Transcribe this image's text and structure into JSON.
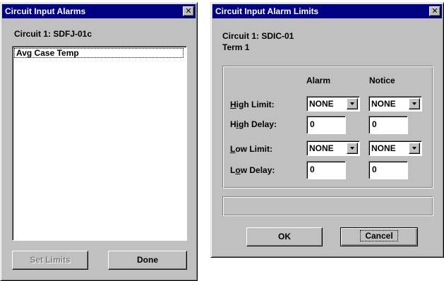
{
  "alarms_dialog": {
    "title": "Circuit Input Alarms",
    "circuit_label": "Circuit 1: SDFJ-01c",
    "list_items": [
      "Avg Case Temp"
    ],
    "set_limits_button": "Set Limits",
    "done_button": "Done"
  },
  "limits_dialog": {
    "title": "Circuit Input Alarm Limits",
    "circuit_label": "Circuit 1: SDIC-01",
    "term_label": "Term 1",
    "col_alarm": "Alarm",
    "col_notice": "Notice",
    "rows": [
      {
        "label": "High Limit:",
        "alarm": "NONE",
        "notice": "NONE"
      },
      {
        "label": "High Delay:",
        "alarm": "0",
        "notice": "0"
      },
      {
        "label": "Low Limit:",
        "alarm": "NONE",
        "notice": "NONE"
      },
      {
        "label": "Low Delay:",
        "alarm": "0",
        "notice": "0"
      }
    ],
    "status_text": "",
    "ok_button": "OK",
    "cancel_button": "Cancel"
  },
  "colors": {
    "titlebar": "#000080",
    "face": "#c0c0c0"
  },
  "icons": [
    "close-icon",
    "chevron-down-icon"
  ]
}
